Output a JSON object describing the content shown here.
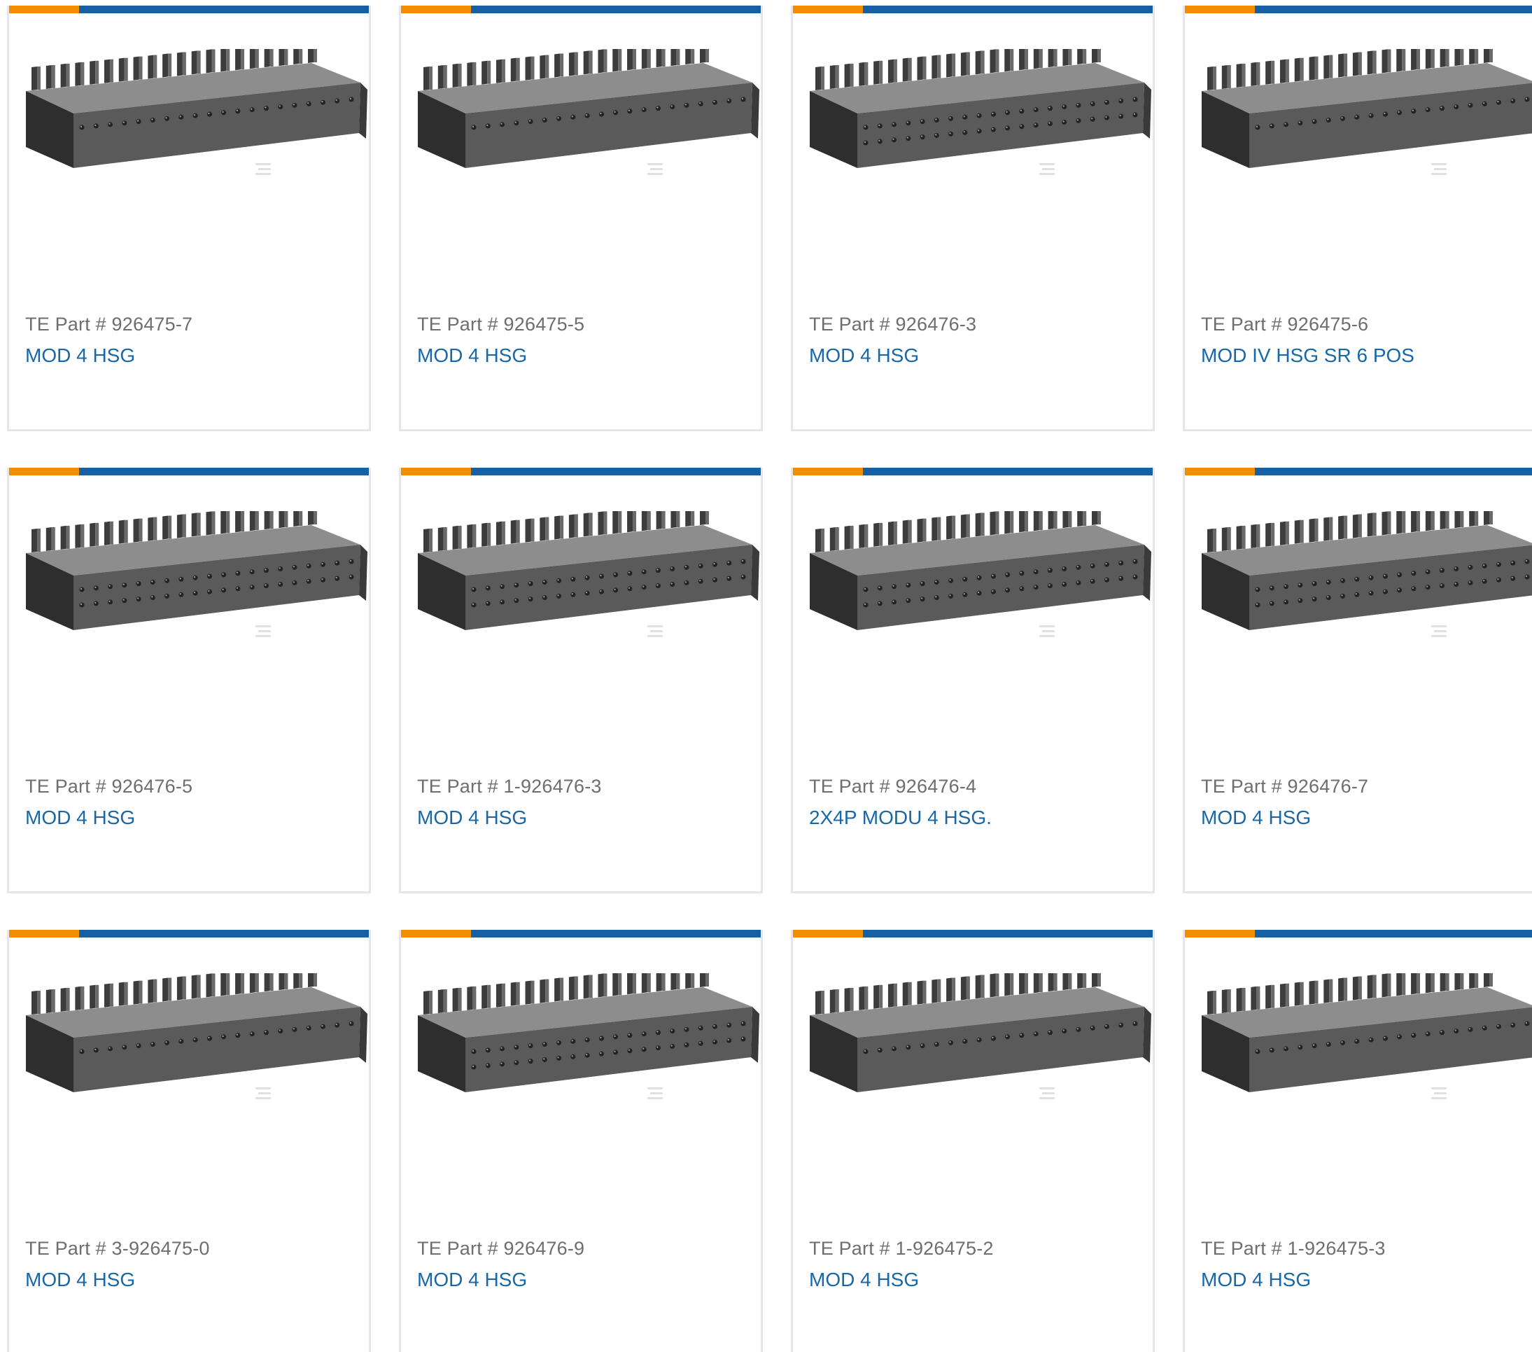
{
  "colors": {
    "accent_orange": "#f28c00",
    "accent_blue": "#1561a3",
    "link_blue": "#1768a6",
    "part_gray": "#6e6e6e",
    "border_gray": "#e6e6e6"
  },
  "products": [
    {
      "part_label": "TE Part # 926475-7",
      "description": "MOD 4 HSG",
      "rows": 1
    },
    {
      "part_label": "TE Part # 926475-5",
      "description": "MOD 4 HSG",
      "rows": 1
    },
    {
      "part_label": "TE Part # 926476-3",
      "description": "MOD 4 HSG",
      "rows": 2
    },
    {
      "part_label": "TE Part # 926475-6",
      "description": "MOD IV HSG SR 6 POS",
      "rows": 1
    },
    {
      "part_label": "TE Part # 926476-5",
      "description": "MOD 4 HSG",
      "rows": 2
    },
    {
      "part_label": "TE Part # 1-926476-3",
      "description": "MOD 4 HSG",
      "rows": 2
    },
    {
      "part_label": "TE Part # 926476-4",
      "description": "2X4P MODU 4 HSG.",
      "rows": 2
    },
    {
      "part_label": "TE Part # 926476-7",
      "description": "MOD 4 HSG",
      "rows": 2
    },
    {
      "part_label": "TE Part # 3-926475-0",
      "description": "MOD 4 HSG",
      "rows": 1
    },
    {
      "part_label": "TE Part # 926476-9",
      "description": "MOD 4 HSG",
      "rows": 2
    },
    {
      "part_label": "TE Part # 1-926475-2",
      "description": "MOD 4 HSG",
      "rows": 1
    },
    {
      "part_label": "TE Part # 1-926475-3",
      "description": "MOD 4 HSG",
      "rows": 1
    }
  ]
}
